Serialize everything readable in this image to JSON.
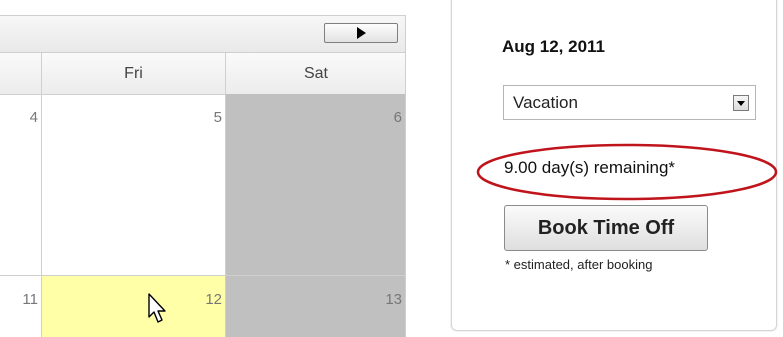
{
  "calendar": {
    "next_icon": "triangle-right-icon",
    "days_of_week": [
      "Fri",
      "Sat"
    ],
    "week1": {
      "thu": "4",
      "fri": "5",
      "sat": "6"
    },
    "week2": {
      "thu": "11",
      "fri": "12",
      "sat": "13"
    },
    "colors": {
      "weekend": "#c0c0c0",
      "selected": "#ffffa8"
    },
    "cursor_icon": "mouse-pointer-icon"
  },
  "panel": {
    "date": "Aug 12, 2011",
    "leave_type": "Vacation",
    "dropdown_icon": "triangle-down-icon",
    "remaining": "9.00 day(s) remaining*",
    "highlight_color": "#c0141c",
    "book_label": "Book Time Off",
    "note": "* estimated, after booking"
  }
}
